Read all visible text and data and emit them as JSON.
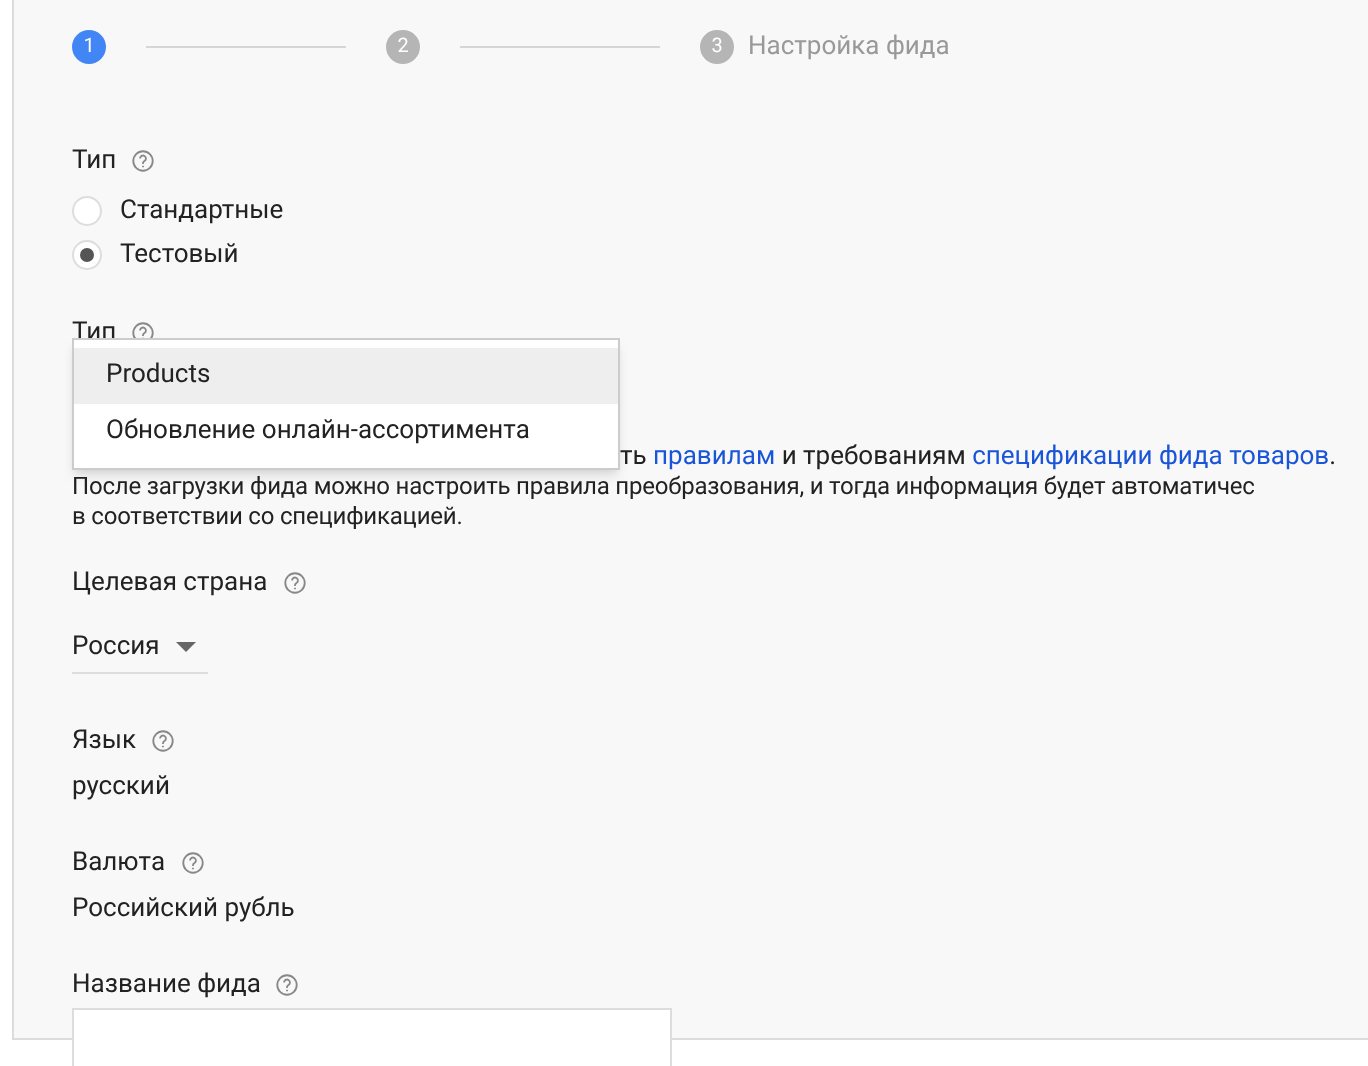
{
  "stepper": [
    {
      "number": "1",
      "active": true
    },
    {
      "number": "2",
      "active": false
    },
    {
      "number": "3",
      "label": "Настройка фида",
      "active": false
    }
  ],
  "type_field": {
    "label": "Тип",
    "options": [
      {
        "label": "Стандартные",
        "selected": false
      },
      {
        "label": "Тестовый",
        "selected": true
      }
    ]
  },
  "type_dropdown": {
    "label": "Тип",
    "menu": [
      {
        "label": "Products",
        "selected": true
      },
      {
        "label": "Обновление онлайн-ассортимента",
        "selected": false
      }
    ]
  },
  "notice": {
    "first_line": [
      {
        "text": "ть "
      },
      {
        "text": "правилам",
        "link": true
      },
      {
        "text": " и требованиям "
      },
      {
        "text": "спецификации фида товаров",
        "link": true
      },
      {
        "text": "."
      }
    ],
    "rest": [
      "После загрузки фида можно настроить правила преобразования, и тогда информация будет автоматичес",
      "в соответствии со спецификацией."
    ]
  },
  "country": {
    "label": "Целевая страна",
    "value": "Россия"
  },
  "language": {
    "label": "Язык",
    "value": "русский"
  },
  "currency": {
    "label": "Валюта",
    "value": "Российский рубль"
  },
  "feed_name": {
    "label": "Название фида"
  }
}
